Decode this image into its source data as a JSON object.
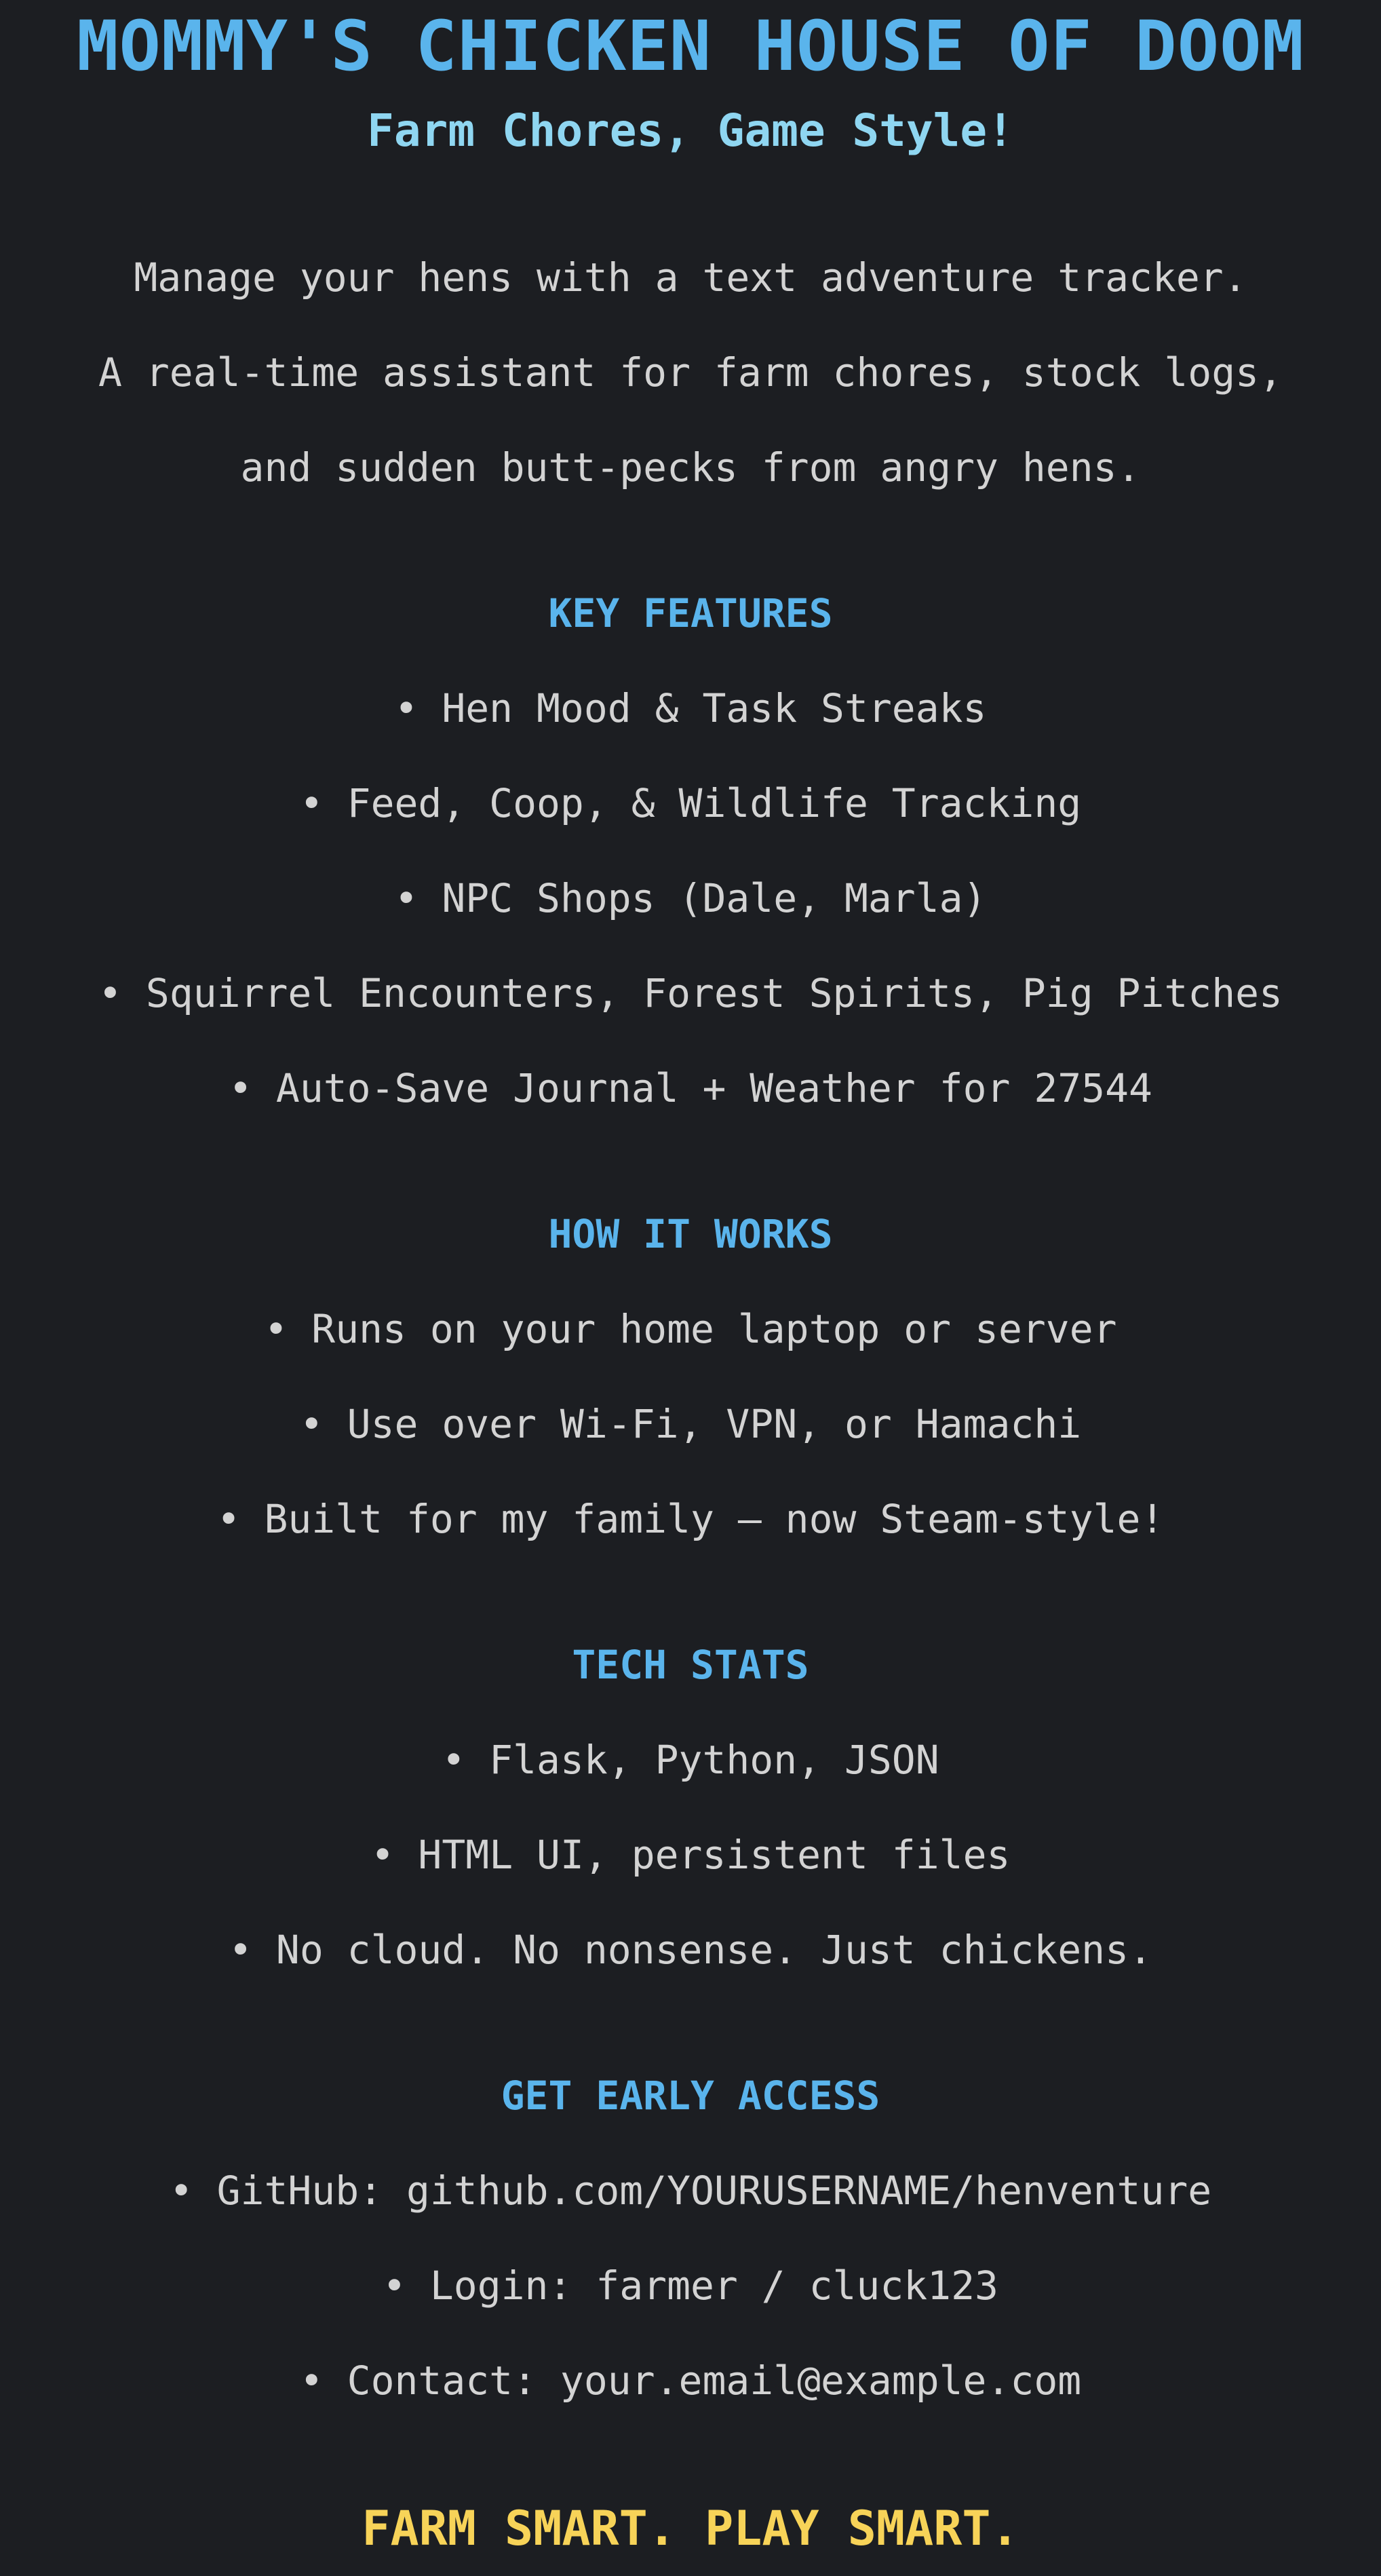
{
  "header": {
    "title": "MOMMY'S CHICKEN HOUSE OF DOOM",
    "subtitle": "Farm Chores, Game Style!"
  },
  "intro": [
    "Manage your hens with a text adventure tracker.",
    "A real-time assistant for farm chores, stock logs,",
    "and sudden butt-pecks from angry hens."
  ],
  "sections": {
    "features": {
      "heading": "KEY FEATURES",
      "items": [
        "• Hen Mood & Task Streaks",
        "• Feed, Coop, & Wildlife Tracking",
        "• NPC Shops (Dale, Marla)",
        "• Squirrel Encounters, Forest Spirits, Pig Pitches",
        "• Auto-Save Journal + Weather for 27544"
      ]
    },
    "how": {
      "heading": "HOW IT WORKS",
      "items": [
        "• Runs on your home laptop or server",
        "• Use over Wi-Fi, VPN, or Hamachi",
        "• Built for my family — now Steam-style!"
      ]
    },
    "tech": {
      "heading": "TECH STATS",
      "items": [
        "• Flask, Python, JSON",
        "• HTML UI, persistent files",
        "• No cloud. No nonsense. Just chickens."
      ]
    },
    "access": {
      "heading": "GET EARLY ACCESS",
      "items": [
        "• GitHub: github.com/YOURUSERNAME/henventure",
        "• Login: farmer / cluck123",
        "• Contact: your.email@example.com"
      ]
    }
  },
  "footer": {
    "tagline": "FARM SMART. PLAY SMART."
  },
  "colors": {
    "background": "#1c1e22",
    "title": "#5ab4ec",
    "subtitle": "#8fd6f1",
    "heading": "#5ab4ec",
    "text": "#d3d3d3",
    "tagline": "#f7d358"
  }
}
